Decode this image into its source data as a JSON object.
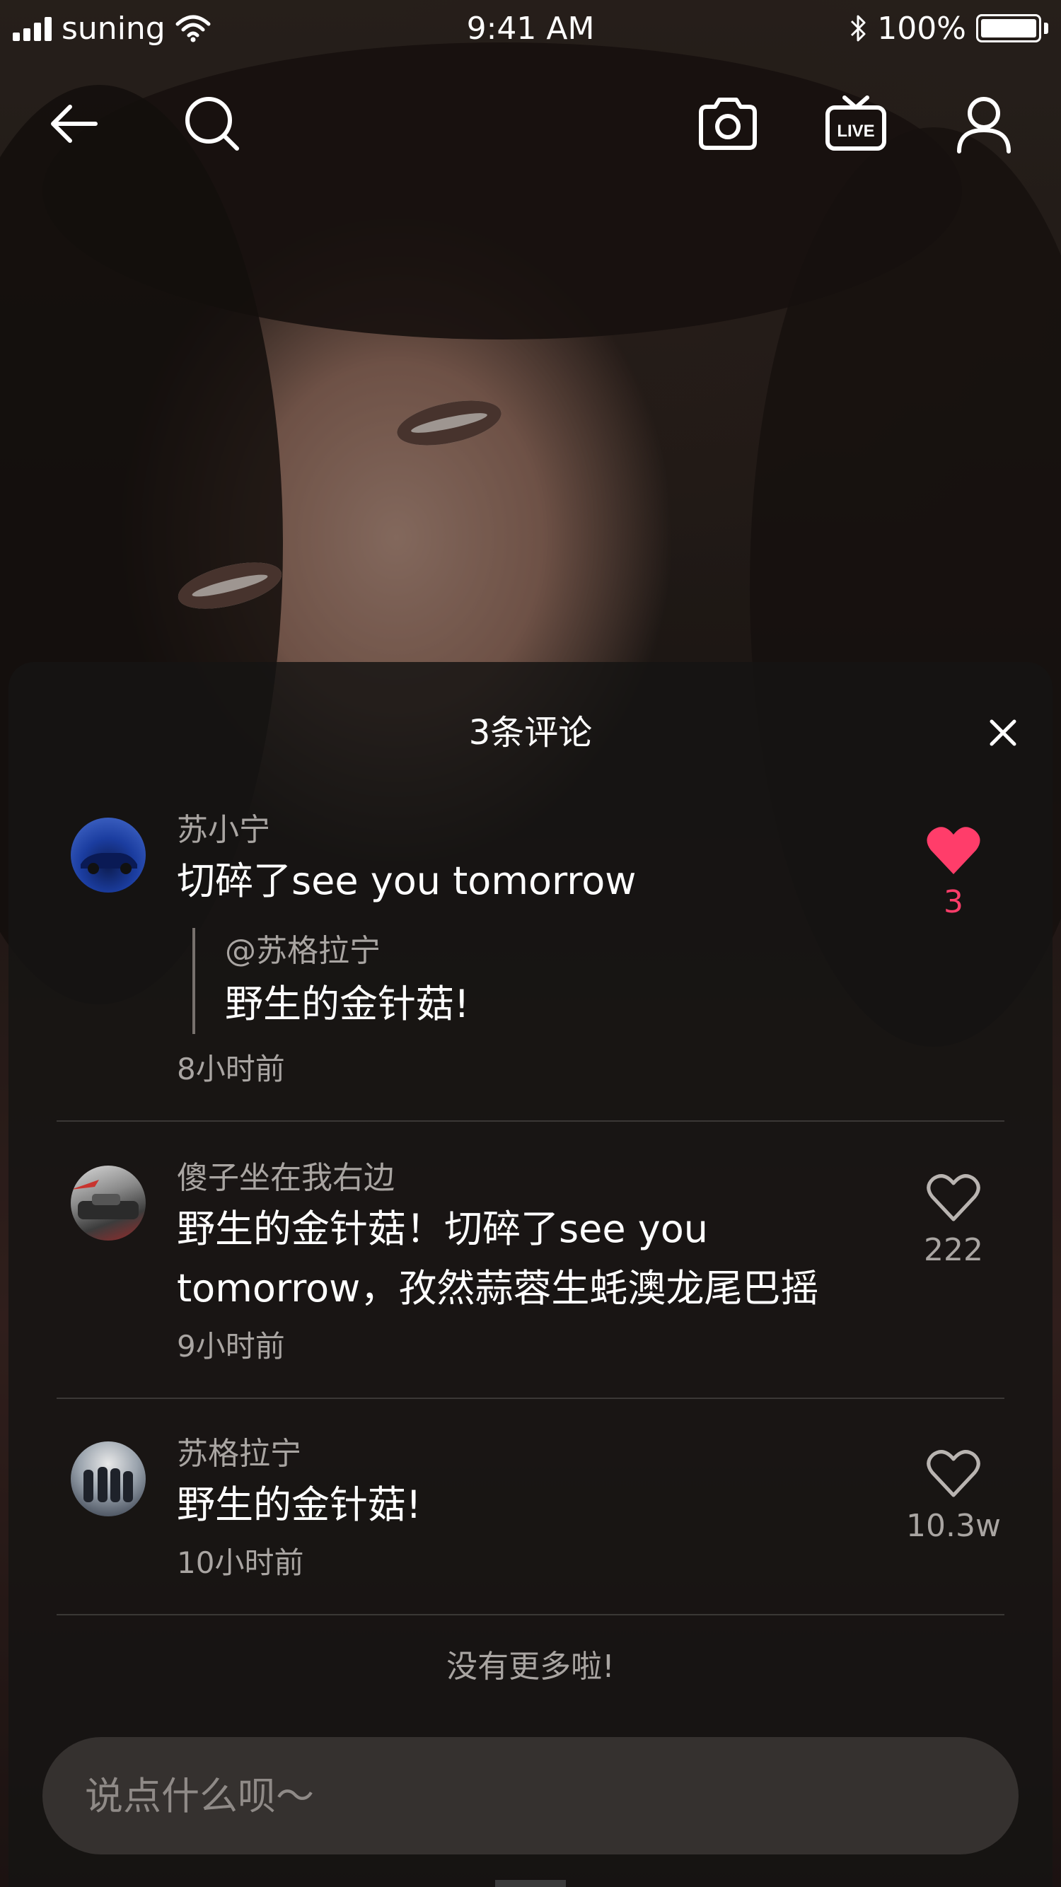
{
  "status_bar": {
    "carrier": "suning",
    "time": "9:41 AM",
    "battery": "100%"
  },
  "nav": {
    "icons": [
      "back-arrow-icon",
      "search-icon",
      "camera-icon",
      "live-tv-icon",
      "profile-icon"
    ],
    "live_label": "LIVE"
  },
  "sheet": {
    "title": "3条评论",
    "comments": [
      {
        "user": "苏小宁",
        "text": "切碎了see you tomorrow",
        "reply": {
          "user": "@苏格拉宁",
          "text": "野生的金针菇!"
        },
        "time": "8小时前",
        "likes": "3",
        "liked": true
      },
      {
        "user": "傻子坐在我右边",
        "text": "野生的金针菇！切碎了see you tomorrow，孜然蒜蓉生蚝澳龙尾巴摇",
        "time": "9小时前",
        "likes": "222",
        "liked": false
      },
      {
        "user": "苏格拉宁",
        "text": "野生的金针菇!",
        "time": "10小时前",
        "likes": "10.3w",
        "liked": false
      }
    ],
    "no_more": "没有更多啦!",
    "input_placeholder": "说点什么呗～"
  },
  "colors": {
    "accent_like": "#ff3d6a",
    "sheet_bg": "#161413",
    "muted_text": "#a9a5a2"
  }
}
